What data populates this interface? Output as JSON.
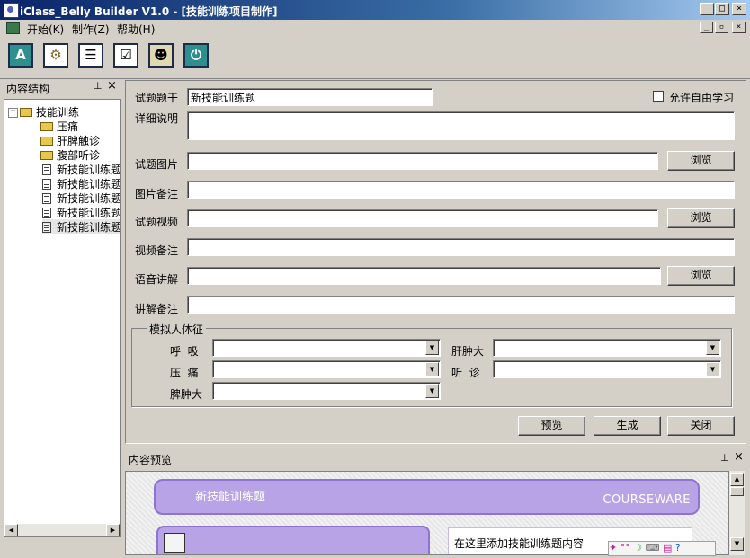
{
  "window": {
    "title": "iClass_Belly Builder V1.0 - [技能训练项目制作]"
  },
  "menu": {
    "items": [
      "开始(K)",
      "制作(Z)",
      "帮助(H)"
    ]
  },
  "toolbar": {
    "icons": [
      "navigate-icon",
      "settings-icon",
      "list-icon",
      "checklist-icon",
      "users-icon",
      "power-icon"
    ]
  },
  "structure_panel": {
    "title": "内容结构",
    "tree": [
      {
        "label": "技能训练",
        "type": "folder",
        "level": 0,
        "expanded": true
      },
      {
        "label": "压痛",
        "type": "folder",
        "level": 1
      },
      {
        "label": "肝脾触诊",
        "type": "folder",
        "level": 1
      },
      {
        "label": "腹部听诊",
        "type": "folder",
        "level": 1
      },
      {
        "label": "新技能训练题",
        "type": "doc",
        "level": 1
      },
      {
        "label": "新技能训练题",
        "type": "doc",
        "level": 1
      },
      {
        "label": "新技能训练题",
        "type": "doc",
        "level": 1
      },
      {
        "label": "新技能训练题",
        "type": "doc",
        "level": 1
      },
      {
        "label": "新技能训练题",
        "type": "doc",
        "level": 1,
        "selected": true
      }
    ]
  },
  "form": {
    "stem_label": "试题题干",
    "stem_value": "新技能训练题",
    "free_study_label": "允许自由学习",
    "detail_label": "详细说明",
    "image_label": "试题图片",
    "image_note_label": "图片备注",
    "video_label": "试题视频",
    "video_note_label": "视频备注",
    "audio_label": "语音讲解",
    "audio_note_label": "讲解备注",
    "browse_label": "浏览",
    "simulation": {
      "title": "模拟人体征",
      "breathing_label": "呼  吸",
      "tenderness_label": "压  痛",
      "spleen_label": "脾肿大",
      "liver_label": "肝肿大",
      "auscultation_label": "听  诊"
    },
    "preview_label": "预览",
    "generate_label": "生成",
    "close_label": "关闭"
  },
  "preview_panel": {
    "title": "内容预览",
    "card_title": "新技能训练题",
    "brand": "COURSEWARE",
    "placeholder_text": "在这里添加技能训练题内容"
  },
  "colors": {
    "titlebar": "#0a246a",
    "face": "#d4d0c8",
    "courseware": "#b7a3e6"
  }
}
